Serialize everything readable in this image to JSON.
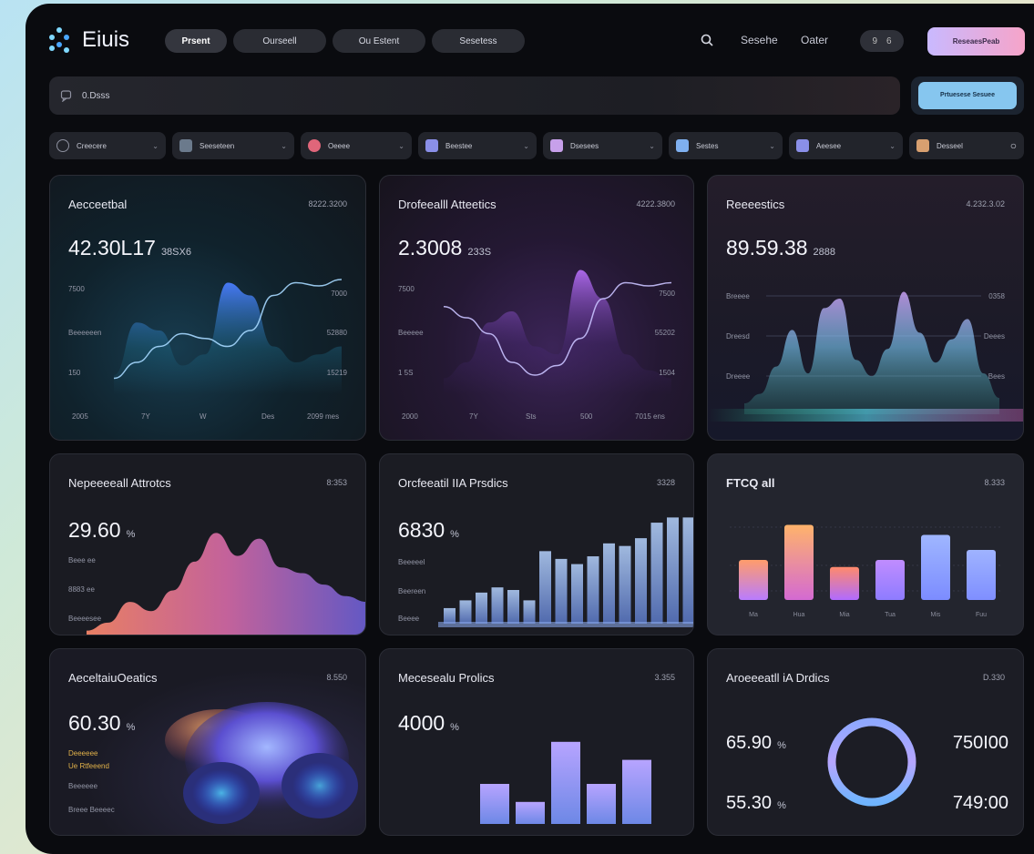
{
  "app": {
    "name": "Eiuis"
  },
  "nav": {
    "tabs": [
      "Prsent",
      "Ourseell",
      "Ou Estent",
      "Sesetess"
    ],
    "active": 0
  },
  "top": {
    "links": [
      "Sesehe",
      "Oater"
    ],
    "toggle_label": "9",
    "toggle_state": "6",
    "cta_label": "ReseaesPeab"
  },
  "search": {
    "value": "0.Dsss",
    "button_label": "Prtuesese Sesuee"
  },
  "filters": [
    {
      "label": "Creecere",
      "color": "#3a3d47"
    },
    {
      "label": "Seeseteen",
      "color": "#6b7a8c"
    },
    {
      "label": "Oeeee",
      "color": "#e0667a"
    },
    {
      "label": "Beestee",
      "color": "#8a8fe8"
    },
    {
      "label": "Dsesees",
      "color": "#c7a0ea"
    },
    {
      "label": "Sestes",
      "color": "#7fb0f0"
    },
    {
      "label": "Aeesee",
      "color": "#8a8fe8"
    },
    {
      "label": "Desseel",
      "color": "#d8a070"
    }
  ],
  "cards": {
    "c1": {
      "title": "Aecceetbal",
      "sub": "8222.3200",
      "value": "42.30L17",
      "unit": "38SX6",
      "yticks": [
        "7500",
        "Beeeeeen",
        "150"
      ],
      "ryticks": [
        "7000",
        "52880",
        "15219"
      ],
      "xticks": [
        "2005",
        "7Y",
        "W",
        "Des",
        "2099 mes"
      ]
    },
    "c2": {
      "title": "Drofeealll Atteetics",
      "sub": "4222.3800",
      "value": "2.3008",
      "unit": "233S",
      "yticks": [
        "7500",
        "Beeeee",
        "1 5S"
      ],
      "ryticks": [
        "7500",
        "55202",
        "1504"
      ],
      "xticks": [
        "2000",
        "7Y",
        "Sts",
        "500",
        "7015 ens"
      ]
    },
    "c3": {
      "title": "Reeeestics",
      "sub": "4.232.3.02",
      "value": "89.59.38",
      "unit": "2888",
      "yticks": [
        "Breeee",
        "Dreesd",
        "Dreeee"
      ],
      "ryticks": [
        "0358",
        "Deees",
        "Bees"
      ]
    },
    "c4": {
      "title": "Nepeeeeall Attrotcs",
      "sub": "8:353",
      "value": "29.60",
      "unit": "%",
      "yticks": [
        "Beee ee",
        "8883 ee",
        "Beeeesee"
      ]
    },
    "c5": {
      "title": "Orcfeeatil IIA Prsdics",
      "sub": "3328",
      "value": "6830",
      "unit": "%",
      "yticks": [
        "Beeeeel",
        "Beereen",
        "Beeee"
      ]
    },
    "c6": {
      "title": "FTCQ all",
      "sub": "8.333"
    },
    "c7": {
      "title": "AeceltaiuOeatics",
      "sub": "8.550",
      "value": "60.30",
      "unit": "%",
      "notes": [
        "Deeeeee",
        "Ue Rtfeeend",
        "Beeeeee",
        "Breee Beeeec"
      ]
    },
    "c8": {
      "title": "Mecesealu Prolics",
      "sub": "3.355",
      "value": "4000",
      "unit": "%"
    },
    "c9": {
      "title": "Aroeeeatll iA Drdics",
      "sub": "D.330",
      "left_top": "65.90",
      "left_bottom": "55.30",
      "right_top": "750I00",
      "right_bottom": "749:00",
      "unit": "%",
      "ring_fraction": 1.0
    }
  },
  "chart_data": [
    {
      "type": "area",
      "title": "Aecceetbal",
      "x": [
        0,
        1,
        2,
        3,
        4,
        5,
        6,
        7,
        8,
        9,
        10
      ],
      "series": [
        {
          "values": [
            12,
            45,
            40,
            18,
            25,
            70,
            62,
            30,
            20,
            25,
            30
          ]
        },
        {
          "values": [
            10,
            20,
            30,
            38,
            35,
            30,
            40,
            62,
            70,
            68,
            72
          ]
        }
      ]
    },
    {
      "type": "area",
      "title": "Drofeealll Atteetics",
      "x": [
        0,
        1,
        2,
        3,
        4,
        5,
        6,
        7,
        8,
        9,
        10
      ],
      "series": [
        {
          "values": [
            10,
            20,
            45,
            52,
            30,
            25,
            78,
            60,
            25,
            15,
            10
          ]
        },
        {
          "values": [
            55,
            48,
            38,
            20,
            12,
            18,
            35,
            60,
            70,
            68,
            70
          ]
        }
      ]
    },
    {
      "type": "area",
      "title": "Reeeestics",
      "series": [
        {
          "values": [
            8,
            15,
            35,
            62,
            30,
            78,
            85,
            40,
            28,
            48,
            90,
            60,
            38,
            55,
            70,
            30,
            12
          ]
        }
      ]
    },
    {
      "type": "area",
      "title": "Nepeeeeall Attrotcs",
      "series": [
        {
          "values": [
            5,
            12,
            30,
            22,
            40,
            65,
            90,
            70,
            85,
            60,
            55,
            45,
            35,
            30
          ]
        }
      ]
    },
    {
      "type": "bar",
      "title": "Orcfeeatil IIA Prsdics",
      "values": [
        12,
        18,
        24,
        28,
        26,
        18,
        56,
        50,
        46,
        52,
        62,
        60,
        66,
        78,
        82,
        82
      ]
    },
    {
      "type": "bar",
      "title": "FTCQ all",
      "categories": [
        "Ma",
        "Hua",
        "Mia",
        "Tua",
        "Mis",
        "Fuu"
      ],
      "values": [
        40,
        75,
        33,
        40,
        65,
        50
      ]
    },
    {
      "type": "bar",
      "title": "Mecesealu Prolics",
      "values": [
        40,
        22,
        82,
        40,
        64
      ]
    }
  ]
}
